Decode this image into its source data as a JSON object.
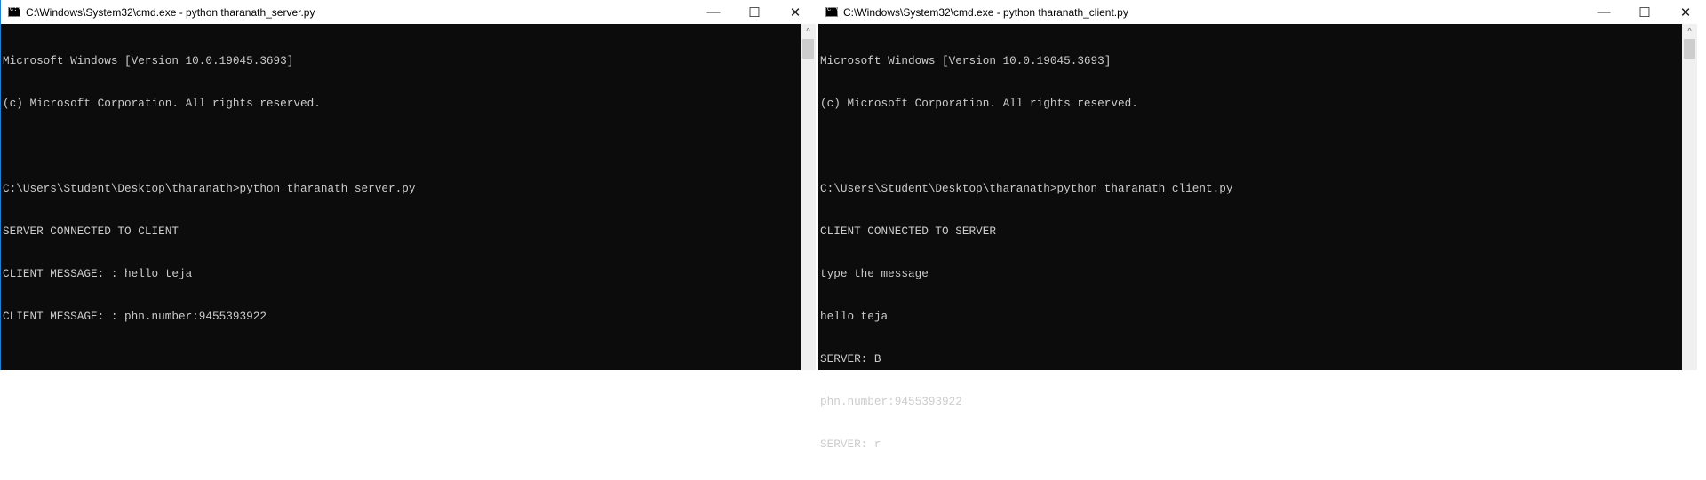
{
  "left_window": {
    "title": "C:\\Windows\\System32\\cmd.exe - python  tharanath_server.py",
    "controls": {
      "minimize": "—",
      "maximize": "☐",
      "close": "✕"
    },
    "lines": [
      "Microsoft Windows [Version 10.0.19045.3693]",
      "(c) Microsoft Corporation. All rights reserved.",
      "",
      "C:\\Users\\Student\\Desktop\\tharanath>python tharanath_server.py",
      "SERVER CONNECTED TO CLIENT",
      "CLIENT MESSAGE: : hello teja",
      "CLIENT MESSAGE: : phn.number:9455393922"
    ]
  },
  "right_window": {
    "title": "C:\\Windows\\System32\\cmd.exe - python  tharanath_client.py",
    "controls": {
      "minimize": "—",
      "maximize": "☐",
      "close": "✕"
    },
    "lines": [
      "Microsoft Windows [Version 10.0.19045.3693]",
      "(c) Microsoft Corporation. All rights reserved.",
      "",
      "C:\\Users\\Student\\Desktop\\tharanath>python tharanath_client.py",
      "CLIENT CONNECTED TO SERVER",
      "type the message",
      "hello teja",
      "SERVER: B",
      "phn.number:9455393922",
      "SERVER: r"
    ]
  },
  "scroll_up_glyph": "^"
}
